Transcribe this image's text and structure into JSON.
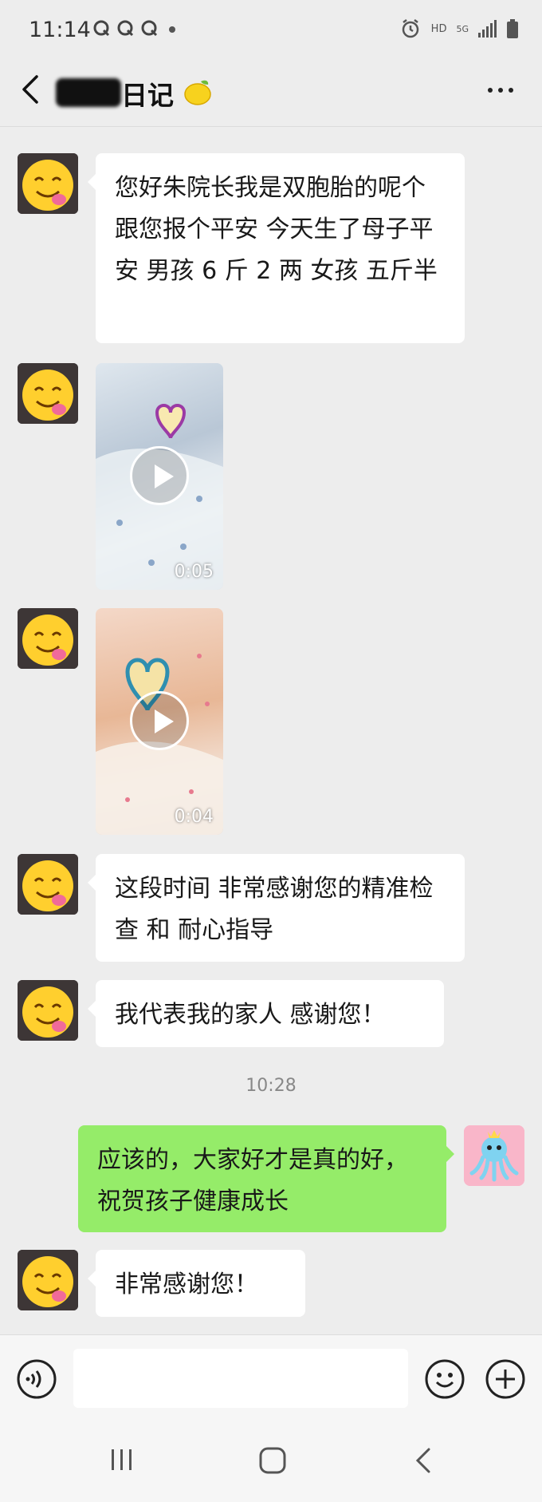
{
  "status_bar": {
    "time": "11:14",
    "right_labels": [
      "HD",
      "5G"
    ]
  },
  "header": {
    "title": "日记",
    "title_blur_present": true
  },
  "messages": [
    {
      "from": "them",
      "type": "text",
      "text": "您好朱院长我是双胞胎的呢个 跟您报个平安  今天生了母子平安  男孩 6 斤 2 两  女孩 五斤半"
    },
    {
      "from": "them",
      "type": "video",
      "duration": "0:05"
    },
    {
      "from": "them",
      "type": "video",
      "duration": "0:04"
    },
    {
      "from": "them",
      "type": "text",
      "text": "这段时间 非常感谢您的精准检查 和 耐心指导"
    },
    {
      "from": "them",
      "type": "text",
      "text": "我代表我的家人 感谢您！"
    },
    {
      "type": "timestamp",
      "text": "10:28"
    },
    {
      "from": "me",
      "type": "text",
      "text": "应该的，大家好才是真的好，祝贺孩子健康成长"
    },
    {
      "from": "them",
      "type": "text",
      "text": "非常感谢您！"
    }
  ],
  "input_bar": {
    "value": "",
    "icons": [
      "voice-icon",
      "emoji-icon",
      "plus-icon"
    ]
  },
  "nav_bar": {
    "icons": [
      "recents-icon",
      "home-icon",
      "back-nav-icon"
    ]
  },
  "colors": {
    "background": "#ededed",
    "my_bubble": "#95ec69",
    "their_bubble": "#ffffff"
  }
}
